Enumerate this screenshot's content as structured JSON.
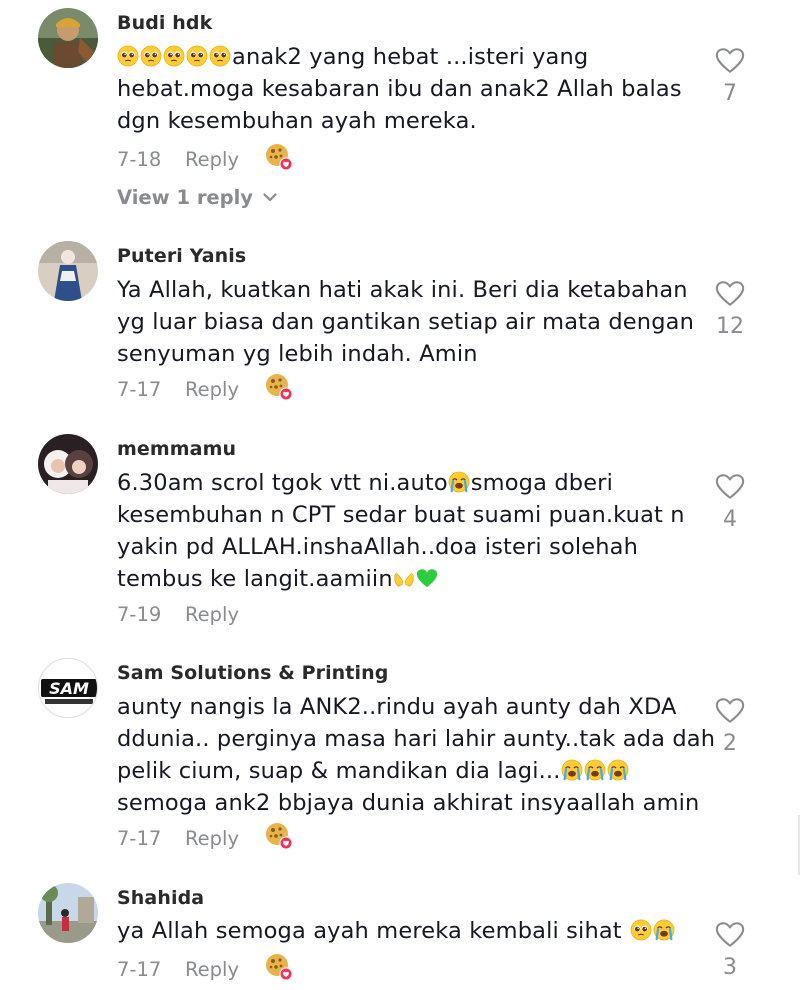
{
  "comments": [
    {
      "username": "Budi hdk",
      "lines": [
        "anak2 yang hebat ...isteri yang",
        "hebat.moga kesabaran ibu dan anak2 Allah balas",
        "dgn kesembuhan ayah mereka."
      ],
      "date": "7-18",
      "reply_label": "Reply",
      "likes": "7",
      "view_replies": "View 1 reply"
    },
    {
      "username": "Puteri Yanis",
      "lines": [
        "Ya Allah, kuatkan hati akak ini. Beri dia ketabahan",
        "yg luar biasa dan gantikan setiap air mata dengan",
        "senyuman yg lebih indah. Amin"
      ],
      "date": "7-17",
      "reply_label": "Reply",
      "likes": "12"
    },
    {
      "username": "memmamu",
      "lines": [
        "6.30am scrol tgok vtt ni.auto",
        "smoga dberi",
        "kesembuhan n CPT sedar buat suami puan.kuat n",
        "yakin pd ALLAH.inshaAllah..doa isteri solehah",
        "tembus ke langit.aamiin"
      ],
      "date": "7-19",
      "reply_label": "Reply",
      "likes": "4"
    },
    {
      "username": "Sam Solutions & Printing",
      "avatar_logo_text": "SAM",
      "lines": [
        "aunty nangis la ANK2..rindu ayah aunty dah XDA",
        "ddunia.. perginya masa hari lahir aunty..tak ada dah",
        "pelik cium, suap & mandikan dia lagi...",
        "semoga ank2 bbjaya dunia akhirat insyaallah amin"
      ],
      "date": "7-17",
      "reply_label": "Reply",
      "likes": "2"
    },
    {
      "username": "Shahida",
      "lines": [
        "ya Allah semoga ayah mereka kembali sihat"
      ],
      "date": "7-17",
      "reply_label": "Reply",
      "likes": "3"
    }
  ],
  "icons": {
    "like": "heart-outline-icon",
    "reaction": "cookie-heart-icon",
    "expand": "chevron-down-icon",
    "emoji_pleading": "pleading-face-emoji",
    "emoji_crying": "loudly-crying-face-emoji",
    "emoji_hands": "palms-up-together-emoji",
    "emoji_heart": "green-heart-emoji"
  },
  "colors": {
    "text": "#161823",
    "secondary": "#8a8b91",
    "emoji_yellow": "#ffcc33",
    "heart_green": "#2ecc40"
  }
}
